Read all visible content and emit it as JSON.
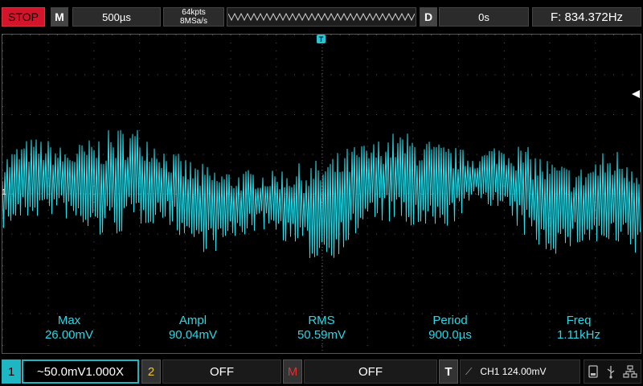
{
  "topbar": {
    "run_state": "STOP",
    "mode_label": "M",
    "timebase": "500µs",
    "memory_depth": "64kpts",
    "sample_rate": "8MSa/s",
    "delay_label": "D",
    "delay_value": "0s",
    "frequency": "F: 834.372Hz"
  },
  "trigger_marker": "T",
  "channel_marker": "1",
  "measurements": [
    {
      "name": "Max",
      "value": "26.00mV"
    },
    {
      "name": "Ampl",
      "value": "90.04mV"
    },
    {
      "name": "RMS",
      "value": "50.59mV"
    },
    {
      "name": "Period",
      "value": "900.0µs"
    },
    {
      "name": "Freq",
      "value": "1.11kHz"
    }
  ],
  "bottombar": {
    "ch1_number": "1",
    "ch1_settings": "~50.0mV1.000X",
    "ch2_number": "2",
    "ch2_state": "OFF",
    "math_label": "M",
    "math_state": "OFF",
    "trigger_label": "T",
    "trigger_edge": "⟋",
    "trigger_settings": "CH1 124.00mV",
    "icons": [
      "file-icon",
      "usb-icon",
      "network-icon"
    ]
  },
  "colors": {
    "trace": "#26e0ee",
    "stop": "#d4142a",
    "ch1": "#1fb6c3",
    "ch2": "#e8c23a",
    "math": "#e03030"
  }
}
